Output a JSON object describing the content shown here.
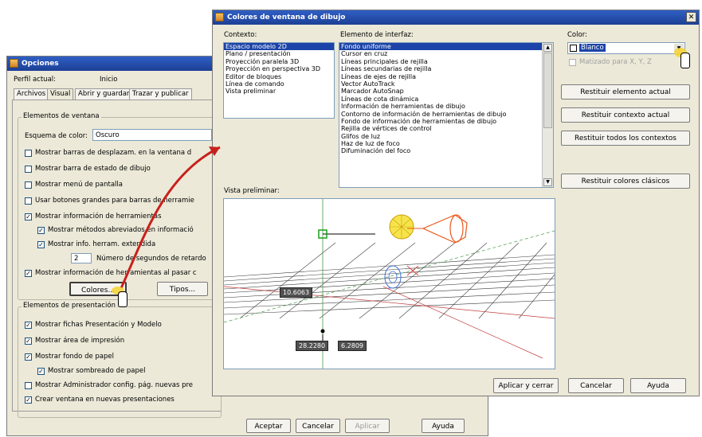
{
  "opciones": {
    "title": "Opciones",
    "perfil_label": "Perfil actual:",
    "perfil_value": "Inicio",
    "tabs": [
      "Archivos",
      "Visual",
      "Abrir y guardar",
      "Trazar y publicar"
    ],
    "group1_title": "Elementos de ventana",
    "esquema_label": "Esquema de color:",
    "esquema_value": "Oscuro",
    "options": [
      {
        "label": "Mostrar barras de desplazam. en la ventana d",
        "checked": false
      },
      {
        "label": "Mostrar barra de estado de dibujo",
        "checked": false
      },
      {
        "label": "Mostrar menú de pantalla",
        "checked": false
      },
      {
        "label": "Usar botones grandes para barras de herramie",
        "checked": false
      },
      {
        "label": "Mostrar información de herramientas",
        "checked": true
      },
      {
        "label": "Mostrar métodos abreviados en informació",
        "checked": true
      },
      {
        "label": "Mostrar info. herram. extendida",
        "checked": true
      },
      {
        "label": "Número de segundos de retardo",
        "value": "2"
      },
      {
        "label": "Mostrar información de herramientas al pasar c",
        "checked": true
      }
    ],
    "colores_button": "Colores...",
    "tipos_button": "Tipos...",
    "group2_title": "Elementos de presentación",
    "options2": [
      {
        "label": "Mostrar fichas Presentación y Modelo",
        "checked": true
      },
      {
        "label": "Mostrar área de impresión",
        "checked": true
      },
      {
        "label": "Mostrar fondo de papel",
        "checked": true
      },
      {
        "label": "Mostrar sombreado de papel",
        "checked": true
      },
      {
        "label": "Mostrar Administrador config. pág. nuevas pre",
        "checked": false
      },
      {
        "label": "Crear ventana en nuevas presentaciones",
        "checked": true
      }
    ],
    "footer_buttons": [
      "Aceptar",
      "Cancelar",
      "Aplicar",
      "Ayuda"
    ]
  },
  "colores": {
    "title": "Colores de ventana de dibujo",
    "contexto_label": "Contexto:",
    "contexto_items": [
      "Espacio modelo 2D",
      "Plano / presentación",
      "Proyección paralela 3D",
      "Proyección en perspectiva 3D",
      "Editor de bloques",
      "Línea de comando",
      "Vista preliminar"
    ],
    "elemento_label": "Elemento de interfaz:",
    "elemento_items": [
      "Fondo uniforme",
      "Cursor en cruz",
      "Líneas principales de rejilla",
      "Líneas secundarias de rejilla",
      "Líneas de ejes de rejilla",
      "Vector AutoTrack",
      "Marcador AutoSnap",
      "Líneas de cota dinámica",
      "Información de herramientas de dibujo",
      "Contorno de información de herramientas de dibujo",
      "Fondo de información de herramientas de dibujo",
      "Rejilla de vértices de control",
      "Glifos de luz",
      "Haz de luz de foco",
      "Difuminación del foco"
    ],
    "color_label": "Color:",
    "color_value": "Blanco",
    "matiz_label": "Matizado para X, Y, Z",
    "buttons": [
      "Restituir elemento actual",
      "Restituir contexto actual",
      "Restituir todos los contextos",
      "Restituir colores clásicos"
    ],
    "vista_label": "Vista preliminar:",
    "preview_labels": [
      "10.6063",
      "28.2280",
      "6.2809"
    ],
    "footer_buttons": [
      "Aplicar y cerrar",
      "Cancelar",
      "Ayuda"
    ]
  },
  "colors": {
    "title_bar": "#1c3f95",
    "selection": "#1c44a8",
    "dialog_bg": "#ece9d8",
    "arrow": "#c8201c"
  }
}
